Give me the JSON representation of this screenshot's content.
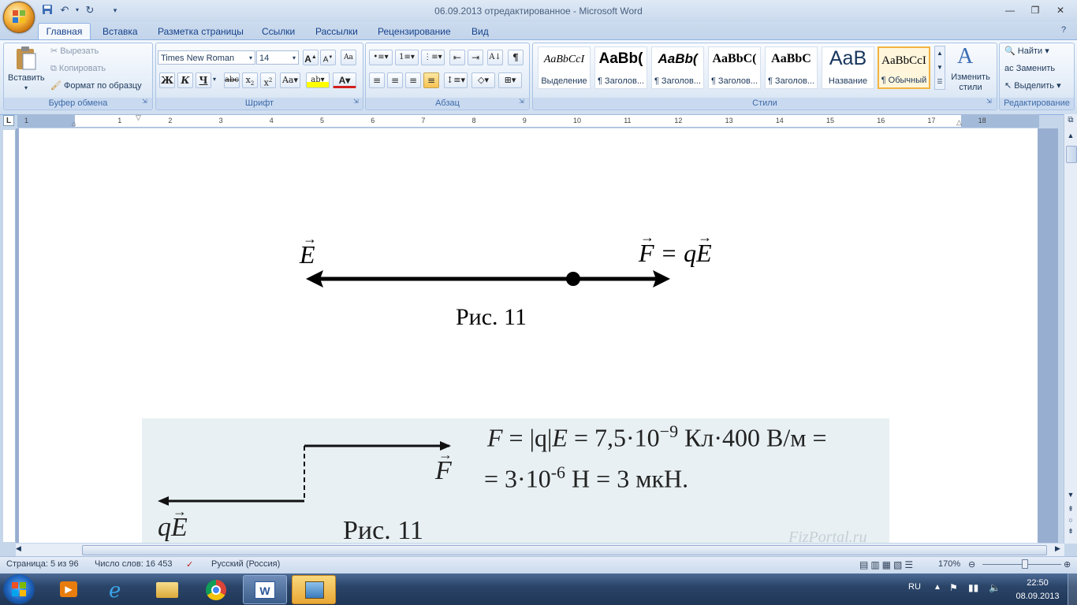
{
  "window": {
    "title": "06.09.2013 отредактированное - Microsoft Word"
  },
  "tabs": [
    "Главная",
    "Вставка",
    "Разметка страницы",
    "Ссылки",
    "Рассылки",
    "Рецензирование",
    "Вид"
  ],
  "clipboard": {
    "paste": "Вставить",
    "cut": "Вырезать",
    "copy": "Копировать",
    "format_painter": "Формат по образцу",
    "label": "Буфер обмена"
  },
  "font": {
    "name": "Times New Roman",
    "size": "14",
    "label": "Шрифт"
  },
  "paragraph": {
    "label": "Абзац"
  },
  "styles": {
    "label": "Стили",
    "change": "Изменить стили",
    "items": [
      {
        "sample": "AaBbCcI",
        "name": "Выделение"
      },
      {
        "sample": "AaBb(",
        "name": "¶ Заголов..."
      },
      {
        "sample": "AaBb(",
        "name": "¶ Заголов..."
      },
      {
        "sample": "AaBbC(",
        "name": "¶ Заголов..."
      },
      {
        "sample": "AaBbC",
        "name": "¶ Заголов..."
      },
      {
        "sample": "AaB",
        "name": "Название"
      },
      {
        "sample": "AaBbCcI",
        "name": "¶ Обычный"
      }
    ]
  },
  "editing": {
    "find": "Найти",
    "replace": "Заменить",
    "select": "Выделить",
    "label": "Редактирование"
  },
  "ruler": {
    "numbers": [
      "1",
      "1",
      "2",
      "3",
      "4",
      "5",
      "6",
      "7",
      "8",
      "9",
      "10",
      "11",
      "12",
      "13",
      "14",
      "15",
      "16",
      "17",
      "18"
    ]
  },
  "document": {
    "fig1": {
      "left_label": "E",
      "right_label_f": "F",
      "right_label_eq": " = q",
      "right_label_e": "E",
      "caption": "Рис. 11"
    },
    "fig2": {
      "eq1_F": "F",
      "eq1_mid": " = |q|",
      "eq1_E": "E",
      "eq1_rest": " = 7,5·10",
      "eq1_exp": "−9",
      "eq1_units": " Кл·400 В/м =",
      "eq2_pre": "= 3·10",
      "eq2_exp": "-6",
      "eq2_rest": " Н = 3 мкН.",
      "vec_F": "F",
      "vec_qE_q": "q",
      "vec_qE_E": "E",
      "caption": "Рис. 11",
      "watermark": "FizPortal.ru"
    }
  },
  "status": {
    "page": "Страница: 5 из 96",
    "words": "Число слов: 16 453",
    "lang": "Русский (Россия)",
    "zoom": "170%"
  },
  "taskbar": {
    "lang": "RU",
    "time": "22:50",
    "date": "08.09.2013"
  },
  "colors": {
    "ribbon_text": "#15428b",
    "figure_bg": "#e8f0f3"
  }
}
